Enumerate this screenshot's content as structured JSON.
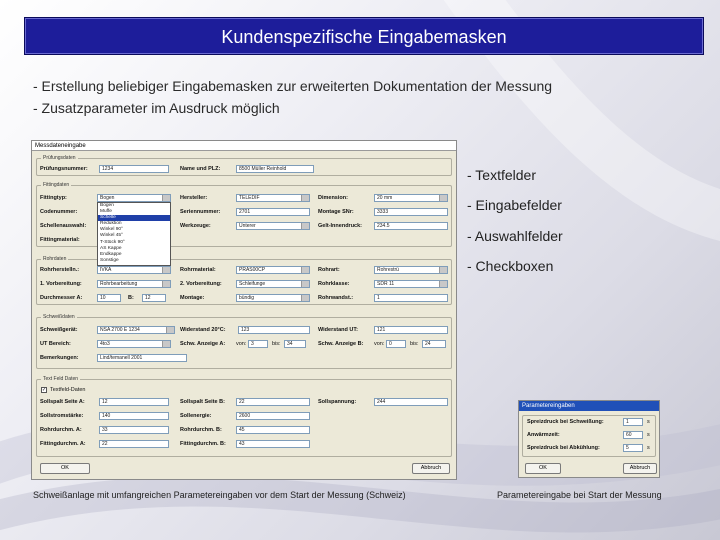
{
  "slide": {
    "title": "Kundenspezifische Eingabemasken",
    "bullets": [
      "- Erstellung beliebiger Eingabemasken zur erweiterten Dokumentation der Messung",
      "- Zusatzparameter im Ausdruck möglich"
    ],
    "side_bullets": [
      "- Textfelder",
      "- Eingabefelder",
      "- Auswahlfelder",
      "- Checkboxen"
    ],
    "caption_left": "Schweißanlage mit umfangreichen Parametereingaben vor dem Start der Messung (Schweiz)",
    "caption_right": "Parametereingabe bei Start der Messung"
  },
  "main_window": {
    "title": "Messdateneingabe",
    "groups": {
      "pruefungsdaten": "Prüfungsdaten",
      "fittingdaten": "Fittingdaten",
      "rohrdaten": "Rohrdaten",
      "schweissdaten": "Schweißdaten",
      "textfeld": "Text Feld Daten"
    },
    "rows": {
      "pruefnummer": {
        "label": "Prüfungsnummer:",
        "value": "1234"
      },
      "name_plz": {
        "label": "Name und PLZ:",
        "value": "8500 Müller Reinhold"
      },
      "fitting": {
        "label": "Fittingtyp:",
        "value": "Bogen"
      },
      "hersteller": {
        "label": "Hersteller:",
        "value": "TELEDIF"
      },
      "dimension": {
        "label": "Dimension:",
        "value": "20 mm"
      },
      "codenummer": {
        "label": "Codenummer:",
        "value": ""
      },
      "seriennummer": {
        "label": "Seriennummer:",
        "value": "2701"
      },
      "montage_snr": {
        "label": "Montage SNr:",
        "value": "3333"
      },
      "schellen": {
        "label": "Schellenauswahl:",
        "value": ""
      },
      "werkzeuge": {
        "label": "Werkzeuge:",
        "value": "Unterer"
      },
      "gelt_innen": {
        "label": "Gelt-Innendruck:",
        "value": "234.5"
      },
      "fittingmaterial": {
        "label": "Fittingmaterial:",
        "value": ""
      },
      "rohrherst": {
        "label": "Rohrherstelln.:",
        "value": "IVKA"
      },
      "rohrmaterial": {
        "label": "Rohrmaterial:",
        "value": "PRAS00CP"
      },
      "rohrart": {
        "label": "Rohrart:",
        "value": "Rohrestrü"
      },
      "vorbereitung1": {
        "label": "1. Vorbereitung:",
        "value": "Rohrbearbeitung"
      },
      "vorbereitung2": {
        "label": "2. Vorbereitung:",
        "value": "Schleifunge"
      },
      "rohrklasse": {
        "label": "Rohrklasse:",
        "value": "SDR 11"
      },
      "durchmesser": {
        "label": "Durchmesser A:",
        "value": "10",
        "b_label": "B:",
        "b_value": "12"
      },
      "montage": {
        "label": "Montage:",
        "value": "bündig"
      },
      "rohrwandstaerke": {
        "label": "Rohrwandst.:",
        "value": "1"
      },
      "schweissgeraet": {
        "label": "Schweißgerät:",
        "value": "NSA 2700 E 1234"
      },
      "widerstand20": {
        "label": "Widerstand 20°C:",
        "value": "123"
      },
      "widerstand_ut": {
        "label": "Widerstand UT:",
        "value": "121"
      },
      "ut_bereich": {
        "label": "UT Bereich:",
        "value": "4to3"
      },
      "schw_anzeige_a": {
        "label": "Schw. Anzeige A:",
        "von": "von:",
        "von_value": "3",
        "bis": "bis:",
        "bis_value": "34"
      },
      "schw_anzeige_b": {
        "label": "Schw. Anzeige B:",
        "von": "von:",
        "von_value": "0",
        "bis": "bis:",
        "bis_value": "24"
      },
      "bemerkungen": {
        "label": "Bemerkungen:",
        "value": "Lind/temanell 2001"
      },
      "textfeld_check": {
        "label": "Textfeld-Daten",
        "checked": true
      },
      "sollspalt_a": {
        "label": "Sollspalt Seite A:",
        "value": "12"
      },
      "sollspalt_b": {
        "label": "Sollspalt Seite B:",
        "value": "22"
      },
      "sollspannung": {
        "label": "Sollspannung:",
        "value": "244"
      },
      "sollstrom": {
        "label": "Sollstromstärke:",
        "value": "140"
      },
      "sollenergie": {
        "label": "Sollenergie:",
        "value": "2600"
      },
      "rohrdurch_a": {
        "label": "Rohrdurchm. A:",
        "value": "33"
      },
      "rohrdurch_b": {
        "label": "Rohrdurchm. B:",
        "value": "45"
      },
      "fittingdurch_a": {
        "label": "Fittingdurchm. A:",
        "value": "22"
      },
      "fittingdurch_b": {
        "label": "Fittingdurchm. B:",
        "value": "43"
      }
    },
    "fitting_options": [
      "Bogen",
      "Muffe",
      "Schelle",
      "Reduktion",
      "Winkel 90°",
      "Winkel 45°",
      "T-Stück 90°",
      "AS Kappe",
      "Endkappe",
      "Sonstige"
    ],
    "ok_label": "OK",
    "cancel_label": "Abbruch"
  },
  "small_window": {
    "title": "Parametereingaben",
    "rows": [
      {
        "label": "Spreizdruck bei Schweißung:",
        "value": "1",
        "unit": "s"
      },
      {
        "label": "Anwärmzeit:",
        "value": "60",
        "unit": "s"
      },
      {
        "label": "Spreizdruck bei Abkühlung:",
        "value": "5",
        "unit": "s"
      }
    ],
    "ok_label": "OK",
    "cancel_label": "Abbruch"
  }
}
